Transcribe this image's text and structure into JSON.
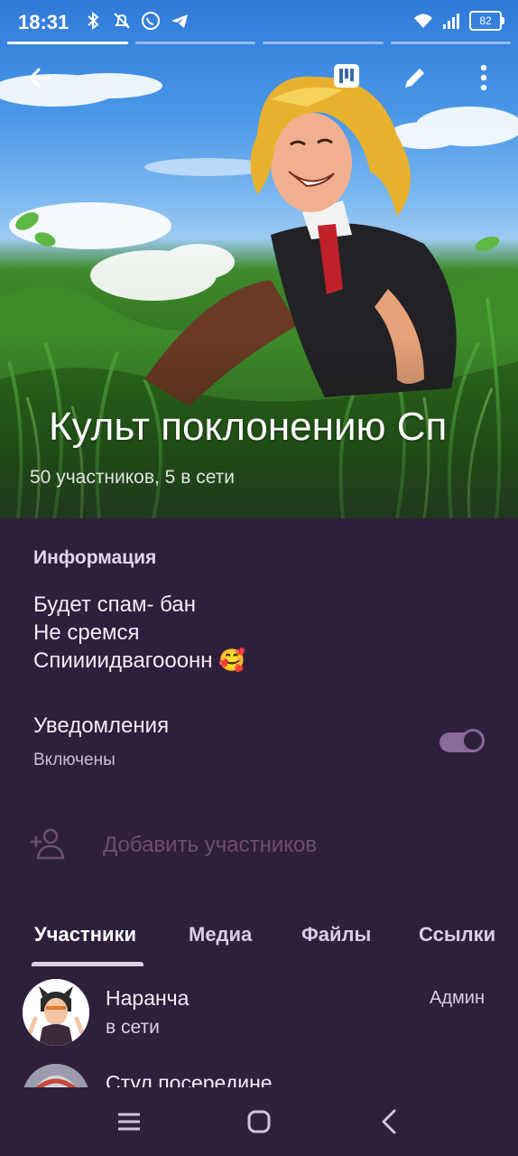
{
  "status_bar": {
    "time": "18:31",
    "battery": "82",
    "notification_icons": [
      "bluetooth-icon",
      "bell-off-icon",
      "whatsapp-icon",
      "telegram-icon"
    ],
    "system_icons": [
      "wifi-icon",
      "signal-icon",
      "battery-icon"
    ]
  },
  "story_progress": {
    "segments": 4,
    "active_segment": 1
  },
  "header": {
    "title": "Культ поклонению Сп",
    "subtitle": "50 участников, 5 в сети",
    "actions": [
      "back-arrow-icon",
      "statistics-icon",
      "edit-pencil-icon",
      "more-vert-icon"
    ]
  },
  "info": {
    "label": "Информация",
    "lines": [
      "Будет спам- бан",
      "Не сремся",
      "Спиииидвагооонн 🥰"
    ]
  },
  "notifications": {
    "title": "Уведомления",
    "status": "Включены",
    "enabled": true
  },
  "add_members": {
    "label": "Добавить участников",
    "icon": "add-person-icon"
  },
  "tabs": [
    {
      "label": "Участники",
      "active": true
    },
    {
      "label": "Медиа",
      "active": false
    },
    {
      "label": "Файлы",
      "active": false
    },
    {
      "label": "Ссылки",
      "active": false
    }
  ],
  "members": [
    {
      "name": "Наранча",
      "status": "в сети",
      "role": "Админ"
    },
    {
      "name": "Стул посередине",
      "status": "",
      "role": ""
    }
  ],
  "nav_bar": [
    "menu-icon",
    "home-icon",
    "back-icon"
  ],
  "colors": {
    "background": "#2e1f3d",
    "toggle_accent": "#8a6a9a",
    "muted_accent": "#6d4f6d"
  }
}
